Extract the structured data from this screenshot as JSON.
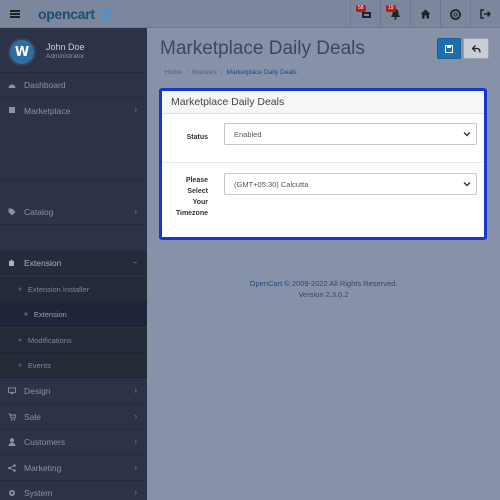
{
  "header": {
    "logo_text": "opencart",
    "badges": [
      "58",
      "19"
    ],
    "icons": [
      "shopping-cart-icon",
      "bell-icon",
      "home-icon",
      "life-ring-icon",
      "sign-out-icon"
    ]
  },
  "sidebar": {
    "user_name": "John Doe",
    "user_role": "Administrator",
    "avatar_letter": "W",
    "items": [
      {
        "label": "Dashboard",
        "icon": "dashboard-icon"
      },
      {
        "label": "Marketplace",
        "icon": "puzzle-icon"
      },
      {
        "label": "Catalog",
        "icon": "tag-icon"
      },
      {
        "label": "Extension",
        "icon": "puzzle-piece-icon"
      },
      {
        "label": "Design",
        "icon": "monitor-icon"
      },
      {
        "label": "Sale",
        "icon": "cart-icon"
      },
      {
        "label": "Customers",
        "icon": "user-icon"
      },
      {
        "label": "Marketing",
        "icon": "share-icon"
      },
      {
        "label": "System",
        "icon": "gear-icon"
      }
    ],
    "sub_items": [
      {
        "label": "Extension Installer"
      },
      {
        "label": "Extension"
      },
      {
        "label": "Modifications"
      },
      {
        "label": "Events"
      }
    ]
  },
  "page": {
    "title": "Marketplace Daily Deals",
    "breadcrumb": [
      "Home",
      "Modules",
      "Marketplace Daily Deals"
    ],
    "separator": "/"
  },
  "panel": {
    "heading": "Marketplace Daily Deals",
    "status_label": "Status",
    "status_value": "Enabled",
    "timezone_label_lines": [
      "Please",
      "Select",
      "Your",
      "Timezone"
    ],
    "timezone_value": "(GMT+05:30) Calcutta"
  },
  "footer": {
    "link": "OpenCart",
    "copyright": " © 2009-2022 All Rights Reserved.",
    "version": "Version 2.3.0.2"
  },
  "colors": {
    "primary": "#1e6fb0",
    "highlight_border": "#1736d0",
    "sidebar_bg": "#2d3346"
  }
}
